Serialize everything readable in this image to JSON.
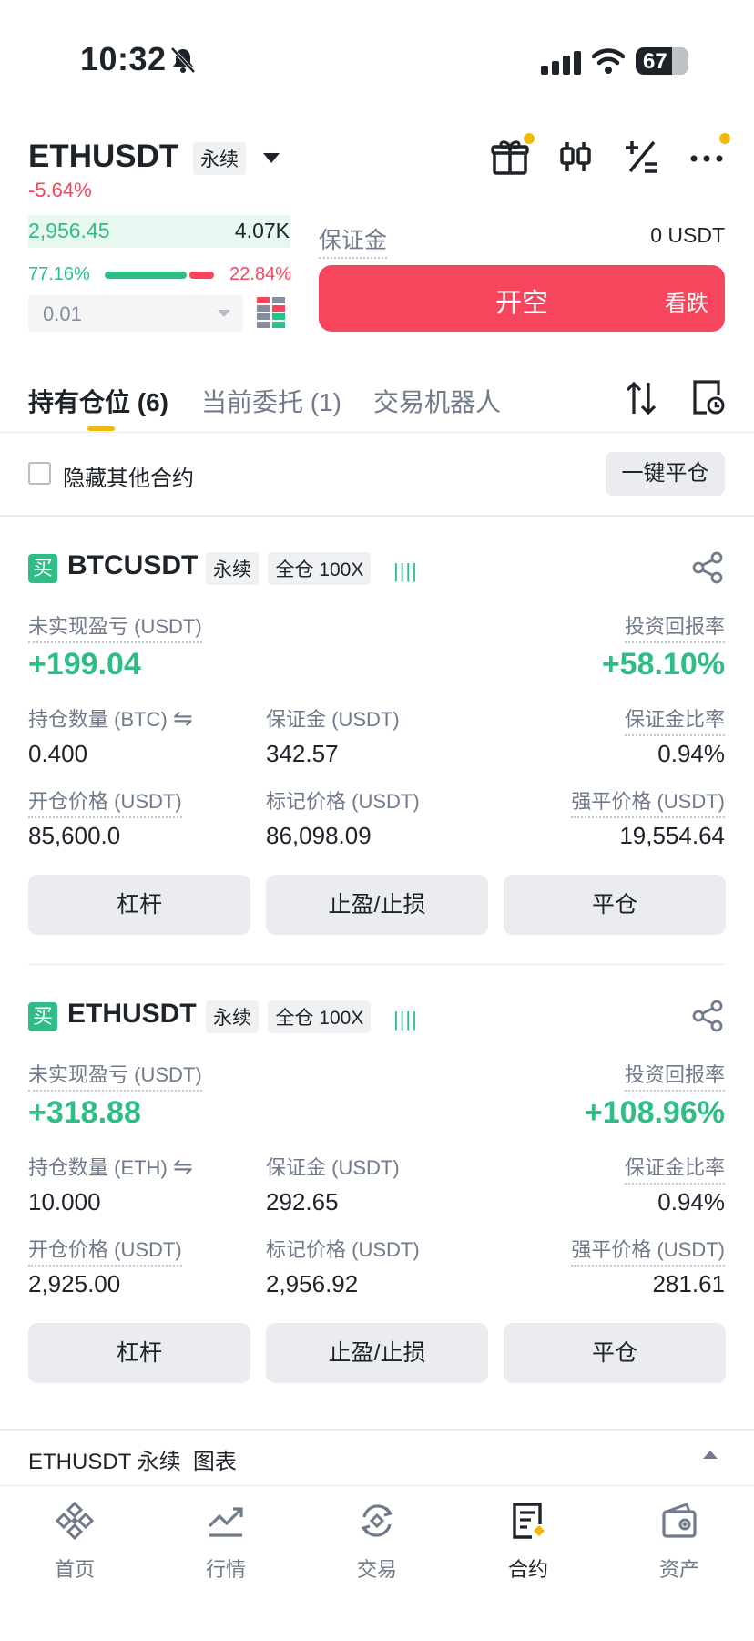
{
  "status_bar": {
    "time": "10:32",
    "battery": "67"
  },
  "header": {
    "pair": "ETHUSDT",
    "contract_type": "永续",
    "change": "-5.64%"
  },
  "order_book": {
    "price": "2,956.45",
    "qty": "4.07K",
    "buy_ratio": "77.16%",
    "sell_ratio": "22.84%",
    "depth": "0.01"
  },
  "trade_panel": {
    "margin_label": "保证金",
    "margin_value": "0 USDT",
    "short_label": "开空",
    "short_sub": "看跌"
  },
  "tabs": [
    {
      "label": "持有仓位 (6)"
    },
    {
      "label": "当前委托 (1)"
    },
    {
      "label": "交易机器人"
    }
  ],
  "filter": {
    "hide_label": "隐藏其他合约",
    "close_all": "一键平仓"
  },
  "positions": [
    {
      "side": "买",
      "symbol": "BTCUSDT",
      "type": "永续",
      "mode": "全仓 100X",
      "pnl_label": "未实现盈亏 (USDT)",
      "pnl": "+199.04",
      "roe_label": "投资回报率",
      "roe": "+58.10%",
      "size_label": "持仓数量 (BTC)",
      "size": "0.400",
      "margin_label": "保证金 (USDT)",
      "margin": "342.57",
      "margin_ratio_label": "保证金比率",
      "margin_ratio": "0.94%",
      "entry_label": "开仓价格 (USDT)",
      "entry": "85,600.0",
      "mark_label": "标记价格 (USDT)",
      "mark": "86,098.09",
      "liq_label": "强平价格 (USDT)",
      "liq": "19,554.64",
      "btn_leverage": "杠杆",
      "btn_tpsl": "止盈/止损",
      "btn_close": "平仓"
    },
    {
      "side": "买",
      "symbol": "ETHUSDT",
      "type": "永续",
      "mode": "全仓 100X",
      "pnl_label": "未实现盈亏 (USDT)",
      "pnl": "+318.88",
      "roe_label": "投资回报率",
      "roe": "+108.96%",
      "size_label": "持仓数量 (ETH)",
      "size": "10.000",
      "margin_label": "保证金 (USDT)",
      "margin": "292.65",
      "margin_ratio_label": "保证金比率",
      "margin_ratio": "0.94%",
      "entry_label": "开仓价格 (USDT)",
      "entry": "2,925.00",
      "mark_label": "标记价格 (USDT)",
      "mark": "2,956.92",
      "liq_label": "强平价格 (USDT)",
      "liq": "281.61",
      "btn_leverage": "杠杆",
      "btn_tpsl": "止盈/止损",
      "btn_close": "平仓"
    }
  ],
  "chart_bar": {
    "label": "ETHUSDT 永续  图表"
  },
  "nav": [
    {
      "label": "首页",
      "icon": "home-diamond-icon"
    },
    {
      "label": "行情",
      "icon": "markets-chart-icon"
    },
    {
      "label": "交易",
      "icon": "trade-swap-icon"
    },
    {
      "label": "合约",
      "icon": "futures-doc-icon"
    },
    {
      "label": "资产",
      "icon": "wallet-icon"
    }
  ],
  "colors": {
    "accent": "#f0b90b",
    "buy": "#2ebd85",
    "sell": "#f6465d"
  }
}
